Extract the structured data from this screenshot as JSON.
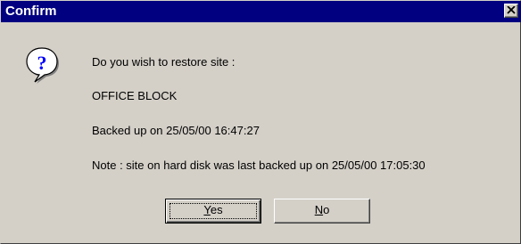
{
  "window": {
    "title": "Confirm",
    "close_glyph": "×"
  },
  "icon": {
    "name": "question-icon"
  },
  "message": {
    "line1": "Do you wish to restore site :",
    "site_name": "OFFICE BLOCK",
    "backup_info": "Backed up on 25/05/00 16:47:27",
    "note": "Note : site on hard disk was last backed up on 25/05/00 17:05:30"
  },
  "buttons": {
    "yes": {
      "mnemonic": "Y",
      "rest": "es"
    },
    "no": {
      "mnemonic": "N",
      "rest": "o"
    }
  },
  "colors": {
    "titlebar": "#000080",
    "face": "#d4d0c8",
    "icon_blue": "#0000ff"
  }
}
